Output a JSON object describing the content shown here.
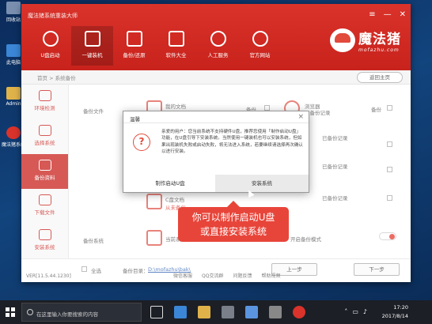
{
  "desktop": {
    "icons": [
      "此电脑",
      "回收站",
      "Admin",
      "魔法猪系统重装大师"
    ]
  },
  "window": {
    "title": "魔法猪系统重装大师",
    "controls": {
      "menu": "≡",
      "minimize": "—",
      "close": "✕"
    }
  },
  "nav": {
    "items": [
      "U盘启动",
      "一键装机",
      "备份/还原",
      "软件大全",
      "人工服务",
      "官方网站"
    ]
  },
  "logo": {
    "name": "魔法猪",
    "sub": "mofazhu.com"
  },
  "breadcrumb": {
    "path": "首页 > 系统备份",
    "back_label": "返回主页"
  },
  "sidebar": {
    "items": [
      "环境检测",
      "选择系统",
      "备份资料",
      "下载文件",
      "安装系统"
    ]
  },
  "content": {
    "backup_files_label": "备份文件",
    "my_docs": "我的文档",
    "browser": "浏览器",
    "c_docs": "C盘文档",
    "c_docs_note": "从未备份",
    "backup_system_label": "备份系统",
    "current_system": "当前系统",
    "backup_label": "备份",
    "item_note_1": "已备份记录",
    "item_note_2": "已备份记录",
    "item_note_3": "已备份记录",
    "item_note_4": "已备份记录",
    "toggle_label": "开启备份模式"
  },
  "footer_row": {
    "select_all": "全选",
    "backup_dir_label": "备份目录：",
    "backup_dir": "D:\\mofazhu\\bak\\",
    "prev": "上一步",
    "next": "下一步"
  },
  "footer": {
    "version": "VER[11.5.44.1230]",
    "links": [
      "微信客服",
      "QQ交流群",
      "问题反馈",
      "帮助视频"
    ]
  },
  "dialog": {
    "title": "温馨",
    "message": "亲爱的用户：您当前系统不支持硬件U盘，推荐您使用「制作启动U盘」功能，在U盘引导下安装系统。当然使用一键装机也可以安装系统，但如果出现装机失败或启动失败，将无法进入系统，若要继续请选择再次确认以进行安装。",
    "btn_make_usb": "制作启动U盘",
    "btn_install": "安装系统"
  },
  "tooltip": {
    "line1": "你可以制作启动U盘",
    "line2": "或直接安装系统"
  },
  "taskbar": {
    "search_placeholder": "在这里输入你要搜索的内容",
    "time": "17:20",
    "date": "2017/8/14"
  },
  "colors": {
    "brand_red": "#c8221c",
    "tooltip_red": "#e8453a"
  }
}
